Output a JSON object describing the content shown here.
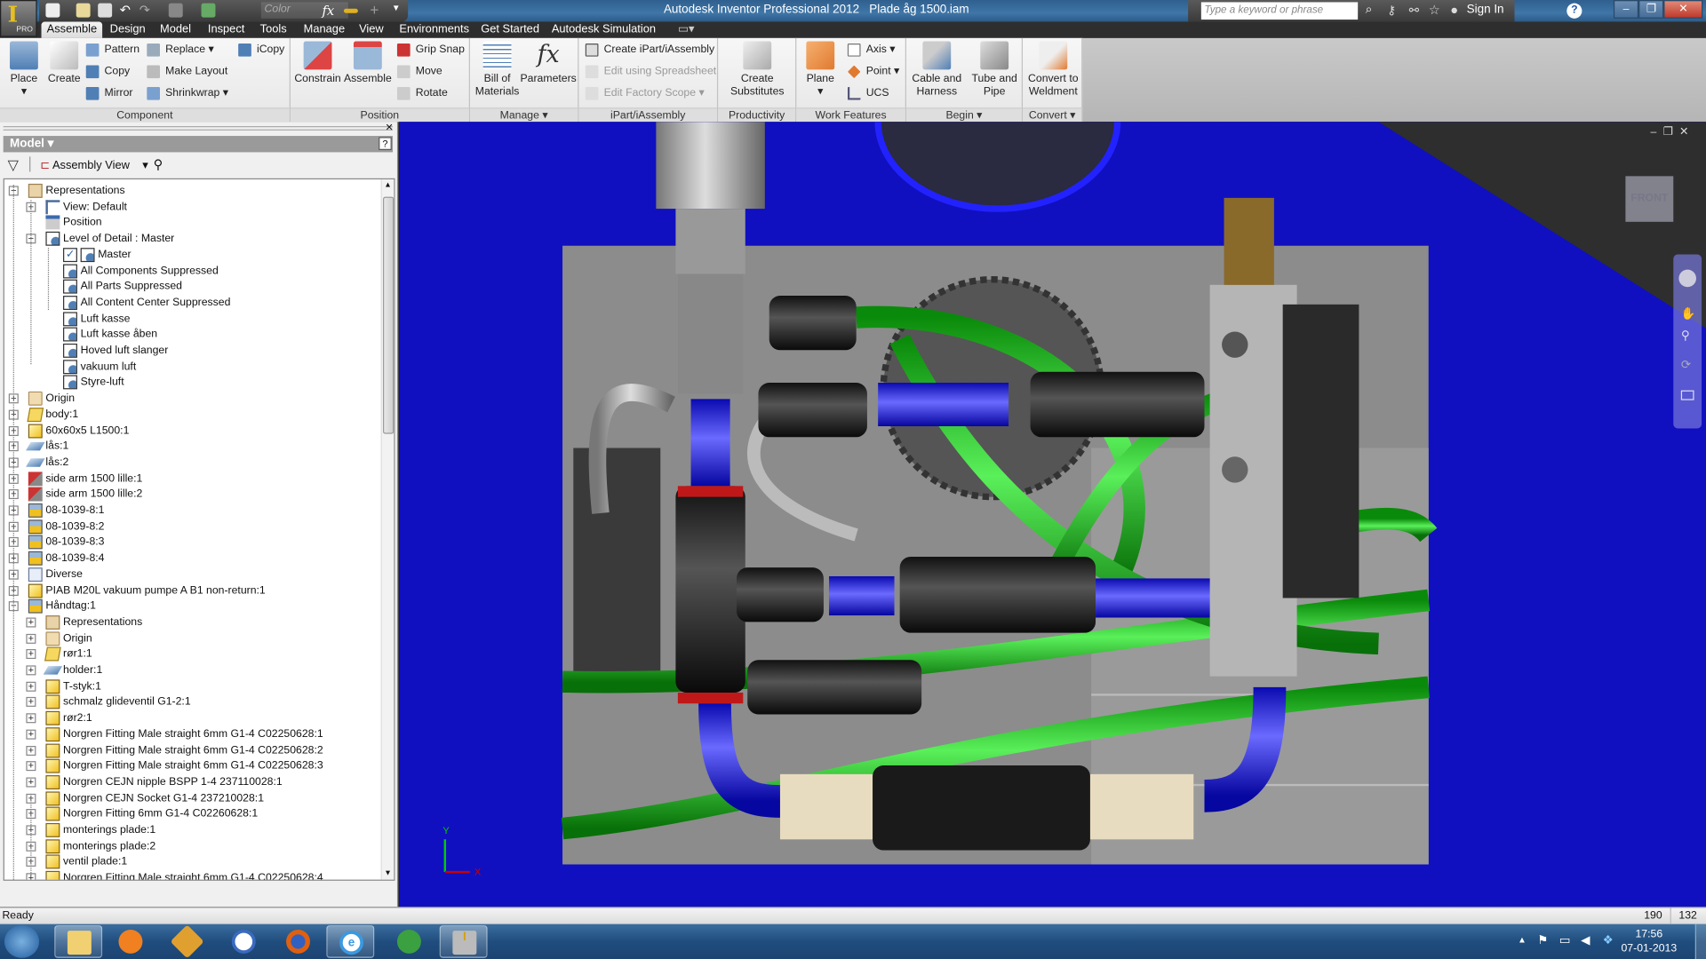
{
  "title_bar": {
    "app_badge": "PRO",
    "color_select": "Color",
    "app_title": "Autodesk Inventor Professional 2012",
    "document": "Plade åg 1500.iam",
    "search_placeholder": "Type a keyword or phrase",
    "sign_in": "Sign In"
  },
  "tabs": [
    "Assemble",
    "Design",
    "Model",
    "Inspect",
    "Tools",
    "Manage",
    "View",
    "Environments",
    "Get Started",
    "Autodesk Simulation"
  ],
  "active_tab": "Assemble",
  "ribbon": {
    "component": {
      "label": "Component",
      "place": "Place",
      "create": "Create",
      "pattern": "Pattern",
      "copy": "Copy",
      "mirror": "Mirror",
      "replace": "Replace",
      "make_layout": "Make Layout",
      "shrinkwrap": "Shrinkwrap",
      "icopy": "iCopy"
    },
    "position": {
      "label": "Position",
      "constrain": "Constrain",
      "assemble": "Assemble",
      "grip_snap": "Grip Snap",
      "move": "Move",
      "rotate": "Rotate"
    },
    "manage": {
      "label": "Manage",
      "bom_1": "Bill of",
      "bom_2": "Materials",
      "parameters": "Parameters"
    },
    "ipart": {
      "label": "iPart/iAssembly",
      "create": "Create iPart/iAssembly",
      "edit_spreadsheet": "Edit using Spreadsheet",
      "edit_factory": "Edit Factory Scope"
    },
    "productivity": {
      "label": "Productivity",
      "sub_1": "Create",
      "sub_2": "Substitutes"
    },
    "work_features": {
      "label": "Work Features",
      "plane": "Plane",
      "axis": "Axis",
      "point": "Point",
      "ucs": "UCS"
    },
    "begin": {
      "label": "Begin",
      "cable_1": "Cable and",
      "cable_2": "Harness",
      "tube_1": "Tube and",
      "tube_2": "Pipe"
    },
    "convert": {
      "label": "Convert",
      "weld_1": "Convert to",
      "weld_2": "Weldment"
    }
  },
  "browser": {
    "title": "Model",
    "view": "Assembly View",
    "items": [
      {
        "label": "Representations",
        "level": 0,
        "exp": "-",
        "icon": "representations"
      },
      {
        "label": "View: Default",
        "level": 1,
        "exp": "+",
        "icon": "view"
      },
      {
        "label": "Position",
        "level": 1,
        "exp": "",
        "icon": "position"
      },
      {
        "label": "Level of Detail : Master",
        "level": 1,
        "exp": "-",
        "icon": "lod"
      },
      {
        "label": "Master",
        "level": 2,
        "exp": "",
        "icon": "lod",
        "checked": true
      },
      {
        "label": "All Components Suppressed",
        "level": 2,
        "exp": "",
        "icon": "lod"
      },
      {
        "label": "All Parts Suppressed",
        "level": 2,
        "exp": "",
        "icon": "lod"
      },
      {
        "label": "All Content Center Suppressed",
        "level": 2,
        "exp": "",
        "icon": "lod"
      },
      {
        "label": "Luft kasse",
        "level": 2,
        "exp": "",
        "icon": "lod"
      },
      {
        "label": "Luft kasse åben",
        "level": 2,
        "exp": "",
        "icon": "lod"
      },
      {
        "label": "Hoved luft slanger",
        "level": 2,
        "exp": "",
        "icon": "lod"
      },
      {
        "label": "vakuum luft",
        "level": 2,
        "exp": "",
        "icon": "lod"
      },
      {
        "label": "Styre-luft",
        "level": 2,
        "exp": "",
        "icon": "lod"
      },
      {
        "label": "Origin",
        "level": 0,
        "exp": "+",
        "icon": "folder"
      },
      {
        "label": "body:1",
        "level": 0,
        "exp": "+",
        "icon": "weldment"
      },
      {
        "label": "60x60x5 L1500:1",
        "level": 0,
        "exp": "+",
        "icon": "part"
      },
      {
        "label": "lås:1",
        "level": 0,
        "exp": "+",
        "icon": "sheetmetal"
      },
      {
        "label": "lås:2",
        "level": 0,
        "exp": "+",
        "icon": "sheetmetal"
      },
      {
        "label": "side arm 1500 lille:1",
        "level": 0,
        "exp": "+",
        "icon": "frame"
      },
      {
        "label": "side arm 1500 lille:2",
        "level": 0,
        "exp": "+",
        "icon": "frame"
      },
      {
        "label": "08-1039-8:1",
        "level": 0,
        "exp": "+",
        "icon": "assembly"
      },
      {
        "label": "08-1039-8:2",
        "level": 0,
        "exp": "+",
        "icon": "assembly"
      },
      {
        "label": "08-1039-8:3",
        "level": 0,
        "exp": "+",
        "icon": "assembly"
      },
      {
        "label": "08-1039-8:4",
        "level": 0,
        "exp": "+",
        "icon": "assembly"
      },
      {
        "label": "Diverse",
        "level": 0,
        "exp": "+",
        "icon": "folder-doc"
      },
      {
        "label": "PIAB M20L vakuum pumpe A B1 non-return:1",
        "level": 0,
        "exp": "+",
        "icon": "part"
      },
      {
        "label": "Håndtag:1",
        "level": 0,
        "exp": "-",
        "icon": "assembly"
      },
      {
        "label": "Representations",
        "level": 1,
        "exp": "+",
        "icon": "representations"
      },
      {
        "label": "Origin",
        "level": 1,
        "exp": "+",
        "icon": "folder"
      },
      {
        "label": "rør1:1",
        "level": 1,
        "exp": "+",
        "icon": "weldment"
      },
      {
        "label": "holder:1",
        "level": 1,
        "exp": "+",
        "icon": "sheetmetal"
      },
      {
        "label": "T-styk:1",
        "level": 1,
        "exp": "+",
        "icon": "part"
      },
      {
        "label": "schmalz glideventil G1-2:1",
        "level": 1,
        "exp": "+",
        "icon": "part"
      },
      {
        "label": "rør2:1",
        "level": 1,
        "exp": "+",
        "icon": "part"
      },
      {
        "label": "Norgren Fitting Male straight 6mm G1-4 C02250628:1",
        "level": 1,
        "exp": "+",
        "icon": "part"
      },
      {
        "label": "Norgren Fitting Male straight 6mm G1-4 C02250628:2",
        "level": 1,
        "exp": "+",
        "icon": "part"
      },
      {
        "label": "Norgren Fitting Male straight 6mm G1-4 C02250628:3",
        "level": 1,
        "exp": "+",
        "icon": "part"
      },
      {
        "label": "Norgren CEJN nipple BSPP 1-4 237110028:1",
        "level": 1,
        "exp": "+",
        "icon": "part"
      },
      {
        "label": "Norgren CEJN Socket G1-4 237210028:1",
        "level": 1,
        "exp": "+",
        "icon": "part"
      },
      {
        "label": "Norgren Fitting 6mm G1-4 C02260628:1",
        "level": 1,
        "exp": "+",
        "icon": "part"
      },
      {
        "label": "monterings plade:1",
        "level": 1,
        "exp": "+",
        "icon": "part"
      },
      {
        "label": "monterings plade:2",
        "level": 1,
        "exp": "+",
        "icon": "part"
      },
      {
        "label": "ventil plade:1",
        "level": 1,
        "exp": "+",
        "icon": "part"
      },
      {
        "label": "Norgren Fitting Male straight 6mm G1-4 C02250628:4",
        "level": 1,
        "exp": "+",
        "icon": "part"
      }
    ]
  },
  "viewport": {
    "viewcube": "FRONT",
    "axis_x": "X",
    "axis_y": "Y",
    "background": "#1010c0"
  },
  "status": {
    "text": "Ready",
    "x": "190",
    "y": "132"
  },
  "taskbar": {
    "time": "17:56",
    "date": "07-01-2013",
    "apps": [
      "windows-explorer",
      "media-player",
      "winamp",
      "flashget",
      "firefox",
      "internet-explorer",
      "utorrent",
      "autodesk-inventor"
    ]
  }
}
